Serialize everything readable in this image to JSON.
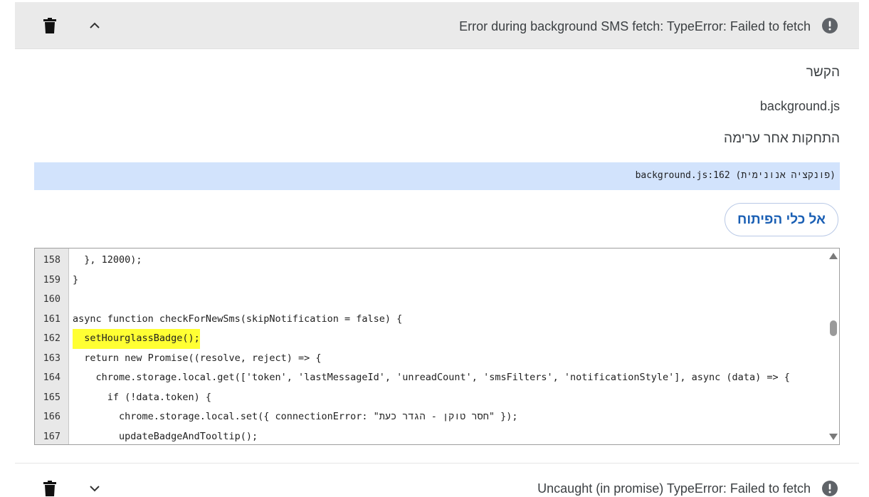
{
  "error1": {
    "title": "Error during background SMS fetch: TypeError: Failed to fetch",
    "context_label": "הקשר",
    "context_value": "background.js",
    "stack_label": "התחקות אחר ערימה",
    "stack_entry": "background.js:162 (פונקציה אנונימית)",
    "devtools_button": "אל כלי הפיתוח"
  },
  "code": {
    "highlighted_line": 162,
    "lines": [
      {
        "num": "158",
        "text": "  }, 12000);"
      },
      {
        "num": "159",
        "text": "}"
      },
      {
        "num": "160",
        "text": ""
      },
      {
        "num": "161",
        "text": "async function checkForNewSms(skipNotification = false) {"
      },
      {
        "num": "162",
        "text": "  setHourglassBadge();"
      },
      {
        "num": "163",
        "text": "  return new Promise((resolve, reject) => {"
      },
      {
        "num": "164",
        "text": "    chrome.storage.local.get(['token', 'lastMessageId', 'unreadCount', 'smsFilters', 'notificationStyle'], async (data) => {"
      },
      {
        "num": "165",
        "text": "      if (!data.token) {"
      },
      {
        "num": "166",
        "text": "        chrome.storage.local.set({ connectionError: \"חסר טוקן - הגדר כעת\" });"
      },
      {
        "num": "167",
        "text": "        updateBadgeAndTooltip();"
      }
    ]
  },
  "error2": {
    "title": "Uncaught (in promise) TypeError: Failed to fetch"
  },
  "icons": {
    "delete": "trash-icon",
    "collapse": "chevron-up-icon",
    "expand": "chevron-down-icon",
    "error": "error-icon"
  },
  "colors": {
    "header_bg": "#eaeaea",
    "stack_highlight": "#d2e3fc",
    "line_highlight": "#ffff33",
    "button_text": "#1a5fb4"
  }
}
